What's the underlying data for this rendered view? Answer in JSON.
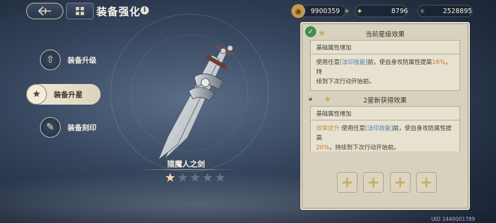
{
  "header": {
    "title": "装备强化",
    "back_icon": "back-arrow-icon",
    "menu_icon": "grid-menu-icon",
    "info_glyph": "i"
  },
  "currencies": [
    {
      "name": "gold-coin",
      "value": "9900359",
      "add": "+",
      "color": "#d9b36a"
    },
    {
      "name": "star-shard",
      "value": "8796",
      "color": "#e0c98a"
    },
    {
      "name": "star-crystal",
      "value": "2528895",
      "color": "#e7d29a"
    }
  ],
  "nav": {
    "items": [
      {
        "label": "装备升级",
        "icon": "upgrade-icon"
      },
      {
        "label": "装备升星",
        "icon": "star-up-icon",
        "active": true
      },
      {
        "label": "装备刻印",
        "icon": "engrave-icon"
      }
    ]
  },
  "weapon": {
    "name": "猎魔人之剑",
    "stars_filled": 1,
    "stars_total": 5
  },
  "panel": {
    "current": {
      "title": "当前星级效果",
      "box_head": "基础属性增加",
      "line1_a": "使用任意",
      "line1_tag": "[法印技能]",
      "line1_b": "前，使自身攻防属性提高",
      "line1_pct": "16%",
      "line1_c": "，持",
      "line2": "续到下次行动开始前。"
    },
    "next": {
      "title": "2星新获得效果",
      "box_head": "基础属性增加",
      "prefix": "效果提升:",
      "line1_a": "使用任意",
      "line1_tag": "[法印技能]",
      "line1_b": "前，使自身攻防属性提高",
      "line2_pct": "20%",
      "line2": "，持续到下次行动开始前。"
    },
    "slots": [
      "+",
      "+",
      "+",
      "+"
    ]
  },
  "footer": {
    "uid": "UID 1440001789"
  },
  "colors": {
    "accent_gold": "#c8ac62",
    "panel_bg": "#d8d1be",
    "highlight_blue": "#4a7cae",
    "highlight_orange": "#d4722d"
  }
}
